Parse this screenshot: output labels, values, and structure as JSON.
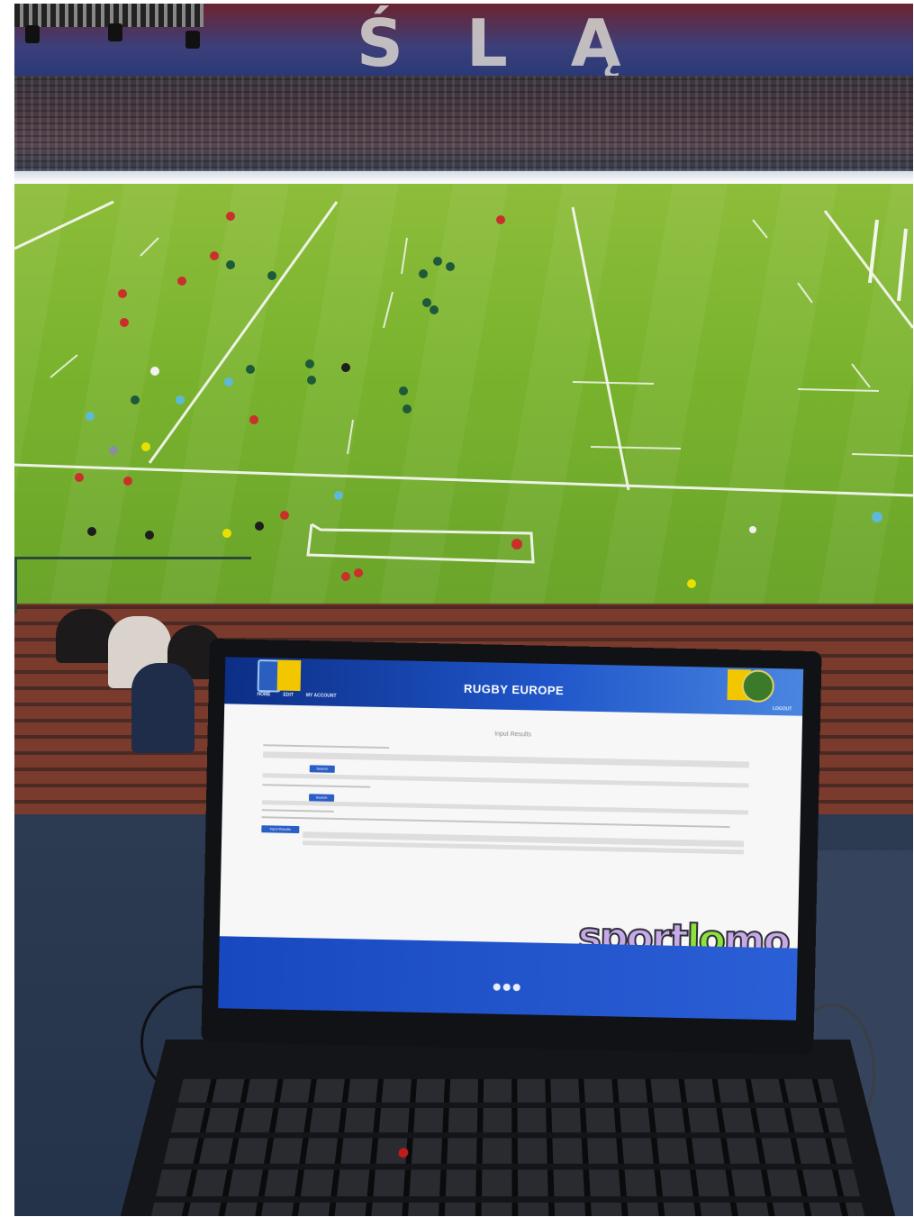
{
  "scene": {
    "description_kind": "photo",
    "screen": {
      "header_title": "RUGBY EUROPE",
      "nav_items": [
        "HOME",
        "EDIT",
        "MY ACCOUNT"
      ],
      "account_link": "LOGOUT",
      "page_title": "Input Results",
      "buttons": [
        "Search",
        "Search",
        "Input Results"
      ],
      "watermark_part1": "sport",
      "watermark_part2": "lo",
      "watermark_part3": "mo"
    },
    "colors": {
      "pitch": "#79b32d",
      "header_blue": "#1f55c9",
      "brand_yellow": "#f2c700"
    }
  }
}
